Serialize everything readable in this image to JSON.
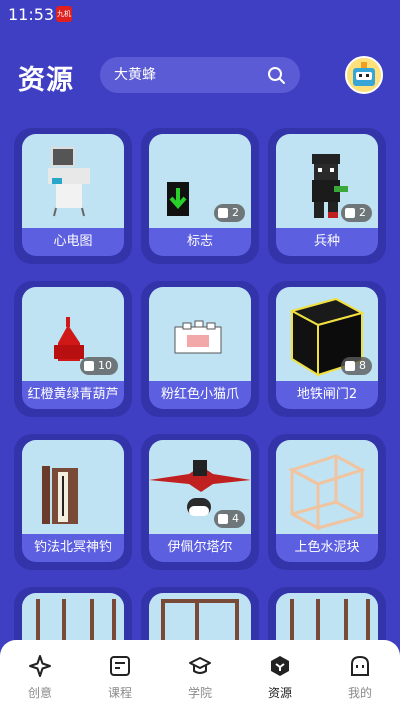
{
  "status_bar": {
    "time": "11:53",
    "badge": "九机"
  },
  "header": {
    "title": "资源",
    "search_placeholder": "大黄蜂",
    "avatar_label": "avatar"
  },
  "resources": [
    {
      "label": "心电图",
      "count": null
    },
    {
      "label": "标志",
      "count": "2"
    },
    {
      "label": "兵种",
      "count": "2"
    },
    {
      "label": "红橙黄绿青葫芦",
      "count": "10"
    },
    {
      "label": "粉红色小猫爪",
      "count": null
    },
    {
      "label": "地铁闸门2",
      "count": "8"
    },
    {
      "label": "钓法北冥神钓",
      "count": null
    },
    {
      "label": "伊佩尔塔尔",
      "count": "4"
    },
    {
      "label": "上色水泥块",
      "count": null
    }
  ],
  "bottom_nav": [
    {
      "label": "创意",
      "icon": "sparkle-icon",
      "active": false
    },
    {
      "label": "课程",
      "icon": "course-icon",
      "active": false
    },
    {
      "label": "学院",
      "icon": "academy-icon",
      "active": false
    },
    {
      "label": "资源",
      "icon": "resource-icon",
      "active": true
    },
    {
      "label": "我的",
      "icon": "profile-icon",
      "active": false
    }
  ]
}
